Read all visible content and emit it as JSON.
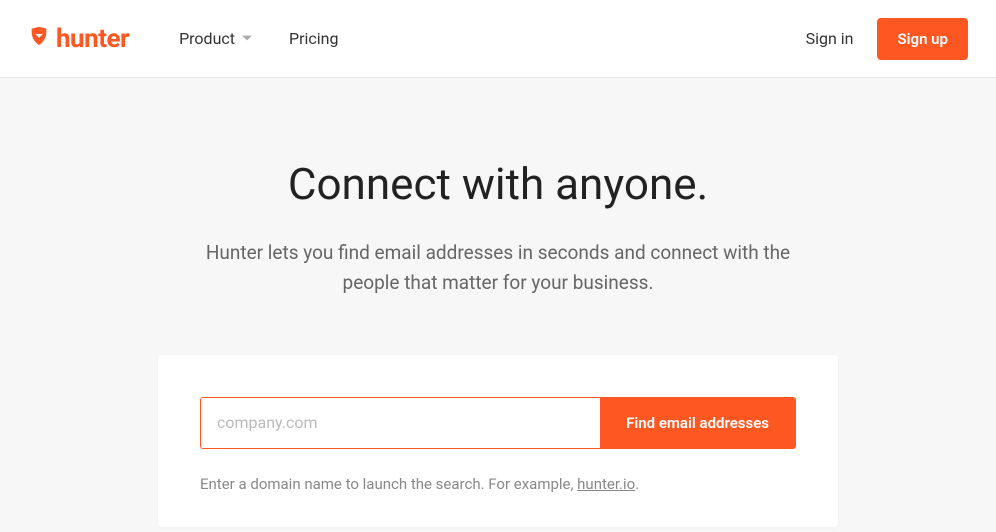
{
  "brand": "hunter",
  "nav": {
    "product": "Product",
    "pricing": "Pricing"
  },
  "auth": {
    "signin": "Sign in",
    "signup": "Sign up"
  },
  "hero": {
    "title": "Connect with anyone.",
    "subtitle": "Hunter lets you find email addresses in seconds and connect with the people that matter for your business."
  },
  "search": {
    "placeholder": "company.com",
    "button": "Find email addresses",
    "hint_prefix": "Enter a domain name to launch the search. For example, ",
    "hint_link": "hunter.io",
    "hint_suffix": "."
  }
}
